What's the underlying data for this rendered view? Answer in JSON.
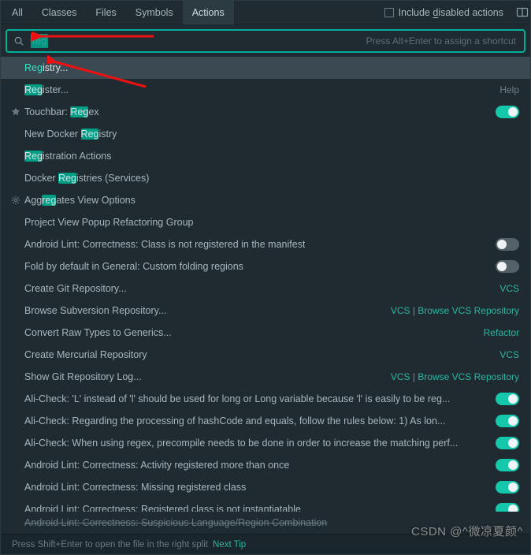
{
  "tabs": {
    "all": "All",
    "classes": "Classes",
    "files": "Files",
    "symbols": "Symbols",
    "actions": "Actions"
  },
  "include_disabled": "Include disabled actions",
  "include_disabled_underline_index": 8,
  "search": {
    "value": "reg",
    "hint": "Press Alt+Enter to assign a shortcut"
  },
  "results": [
    {
      "icon": null,
      "label": "Registry...",
      "hl": "Reg",
      "selected": true,
      "right": null,
      "switch": null
    },
    {
      "icon": null,
      "label": "Register...",
      "hl": "Reg",
      "right": "Help",
      "right_muted": true
    },
    {
      "icon": "star",
      "label": "Touchbar: Regex",
      "hl": "Reg",
      "right": null,
      "switch": true
    },
    {
      "icon": null,
      "label": "New Docker Registry",
      "hl": "Reg"
    },
    {
      "icon": null,
      "label": "Registration Actions",
      "hl": "Reg"
    },
    {
      "icon": null,
      "label": "Docker Registries (Services)",
      "hl": "Reg"
    },
    {
      "icon": "gear",
      "label": "Aggregates View Options",
      "hl": "reg"
    },
    {
      "icon": null,
      "label": "Project View Popup Refactoring Group"
    },
    {
      "icon": null,
      "label": "Android Lint: Correctness: Class is not registered in the manifest",
      "switch": false
    },
    {
      "icon": null,
      "label": "Fold by default in General: Custom folding regions",
      "switch": false
    },
    {
      "icon": null,
      "label": "Create Git Repository...",
      "right": "VCS"
    },
    {
      "icon": null,
      "label": "Browse Subversion Repository...",
      "right": "VCS | Browse VCS Repository"
    },
    {
      "icon": null,
      "label": "Convert Raw Types to Generics...",
      "right": "Refactor"
    },
    {
      "icon": null,
      "label": "Create Mercurial Repository",
      "right": "VCS"
    },
    {
      "icon": null,
      "label": "Show Git Repository Log...",
      "right": "VCS | Browse VCS Repository"
    },
    {
      "icon": null,
      "label": "Ali-Check: 'L' instead of 'l' should be used for long or Long variable because 'l' is easily to be reg...",
      "switch": true
    },
    {
      "icon": null,
      "label": "Ali-Check: Regarding the processing of hashCode and equals, follow the rules below:       1) As lon...",
      "switch": true
    },
    {
      "icon": null,
      "label": "Ali-Check: When using regex, precompile needs to be done in order to increase the matching perf...",
      "switch": true
    },
    {
      "icon": null,
      "label": "Android Lint: Correctness: Activity registered more than once",
      "switch": true
    },
    {
      "icon": null,
      "label": "Android Lint: Correctness: Missing registered class",
      "switch": true
    },
    {
      "icon": null,
      "label": "Android Lint: Correctness: Registered class is not instantiatable",
      "switch": true
    }
  ],
  "cutoff": {
    "label": "Android Lint: Correctness: Suspicious Language/Region Combination",
    "switch": true
  },
  "footer": {
    "text": "Press Shift+Enter to open the file in the right split",
    "link": "Next Tip"
  },
  "watermark": "CSDN @^微凉夏颜^"
}
